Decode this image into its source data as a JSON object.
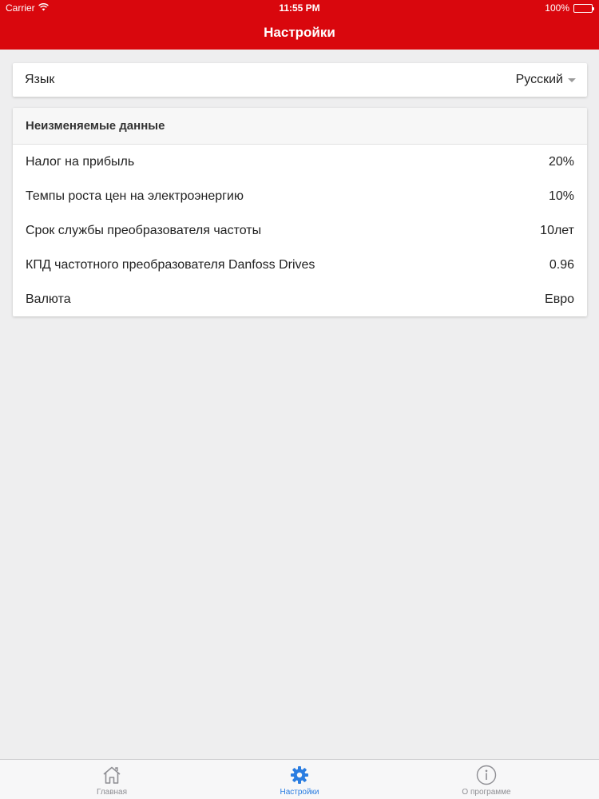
{
  "status_bar": {
    "carrier": "Carrier",
    "time": "11:55 PM",
    "battery": "100%"
  },
  "header": {
    "title": "Настройки"
  },
  "language": {
    "label": "Язык",
    "value": "Русский"
  },
  "fixed_data": {
    "title": "Неизменяемые данные",
    "rows": [
      {
        "label": "Налог на прибыль",
        "value": "20%"
      },
      {
        "label": "Темпы роста цен на электроэнергию",
        "value": "10%"
      },
      {
        "label": "Срок службы преобразователя частоты",
        "value": "10лет"
      },
      {
        "label": "КПД частотного преобразователя Danfoss Drives",
        "value": "0.96"
      },
      {
        "label": "Валюта",
        "value": "Евро"
      }
    ]
  },
  "tabbar": {
    "items": [
      {
        "label": "Главная",
        "icon": "home-icon",
        "active": false
      },
      {
        "label": "Настройки",
        "icon": "gear-icon",
        "active": true
      },
      {
        "label": "О программе",
        "icon": "info-icon",
        "active": false
      }
    ]
  },
  "colors": {
    "header_red": "#d9070d",
    "active_tab_blue": "#2a7de1",
    "inactive_tab_gray": "#8e8e93"
  }
}
